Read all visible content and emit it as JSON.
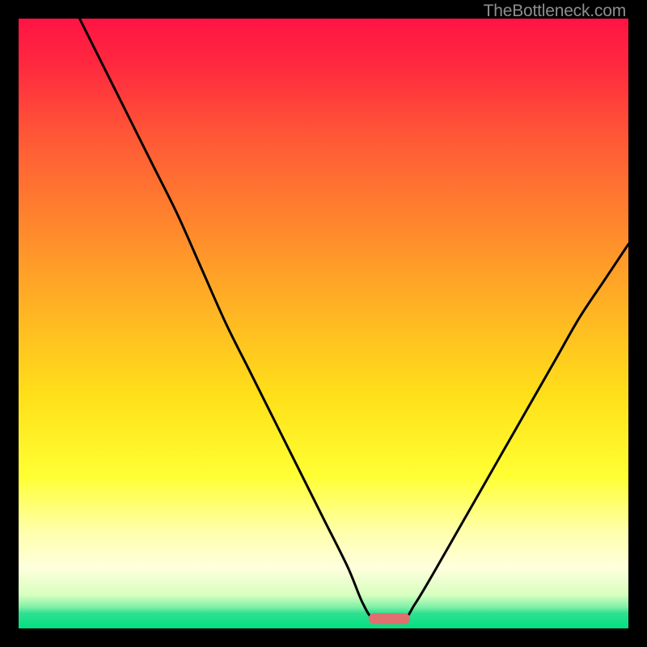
{
  "watermark": "TheBottleneck.com",
  "chart_data": {
    "type": "line",
    "title": "",
    "xlabel": "",
    "ylabel": "",
    "xlim": [
      0,
      100
    ],
    "ylim": [
      0,
      100
    ],
    "gradient_stops": [
      {
        "offset": 0.0,
        "color": "#ff1444"
      },
      {
        "offset": 0.08,
        "color": "#ff2a3f"
      },
      {
        "offset": 0.2,
        "color": "#ff5a36"
      },
      {
        "offset": 0.35,
        "color": "#ff8a2c"
      },
      {
        "offset": 0.5,
        "color": "#ffbb22"
      },
      {
        "offset": 0.62,
        "color": "#ffe019"
      },
      {
        "offset": 0.75,
        "color": "#ffff33"
      },
      {
        "offset": 0.84,
        "color": "#ffffaa"
      },
      {
        "offset": 0.9,
        "color": "#ffffdd"
      },
      {
        "offset": 0.945,
        "color": "#d8ffc0"
      },
      {
        "offset": 0.965,
        "color": "#80f0a8"
      },
      {
        "offset": 0.975,
        "color": "#30e090"
      },
      {
        "offset": 1.0,
        "color": "#00e080"
      }
    ],
    "series": [
      {
        "name": "bottleneck-curve",
        "x": [
          10,
          14,
          18,
          22,
          26,
          30,
          34,
          38,
          42,
          46,
          50,
          54,
          56.5,
          58.5,
          63,
          65,
          68,
          72,
          76,
          80,
          84,
          88,
          92,
          96,
          100
        ],
        "y": [
          100,
          92,
          84,
          76,
          68,
          59,
          50,
          42,
          34,
          26,
          18,
          10,
          4,
          1.5,
          1.5,
          4,
          9,
          16,
          23,
          30,
          37,
          44,
          51,
          57,
          63
        ]
      }
    ],
    "marker": {
      "name": "optimal-pill",
      "cx": 60.8,
      "cy": 1.6,
      "width": 6.8,
      "height": 1.8,
      "fill": "#e26f6f"
    }
  }
}
